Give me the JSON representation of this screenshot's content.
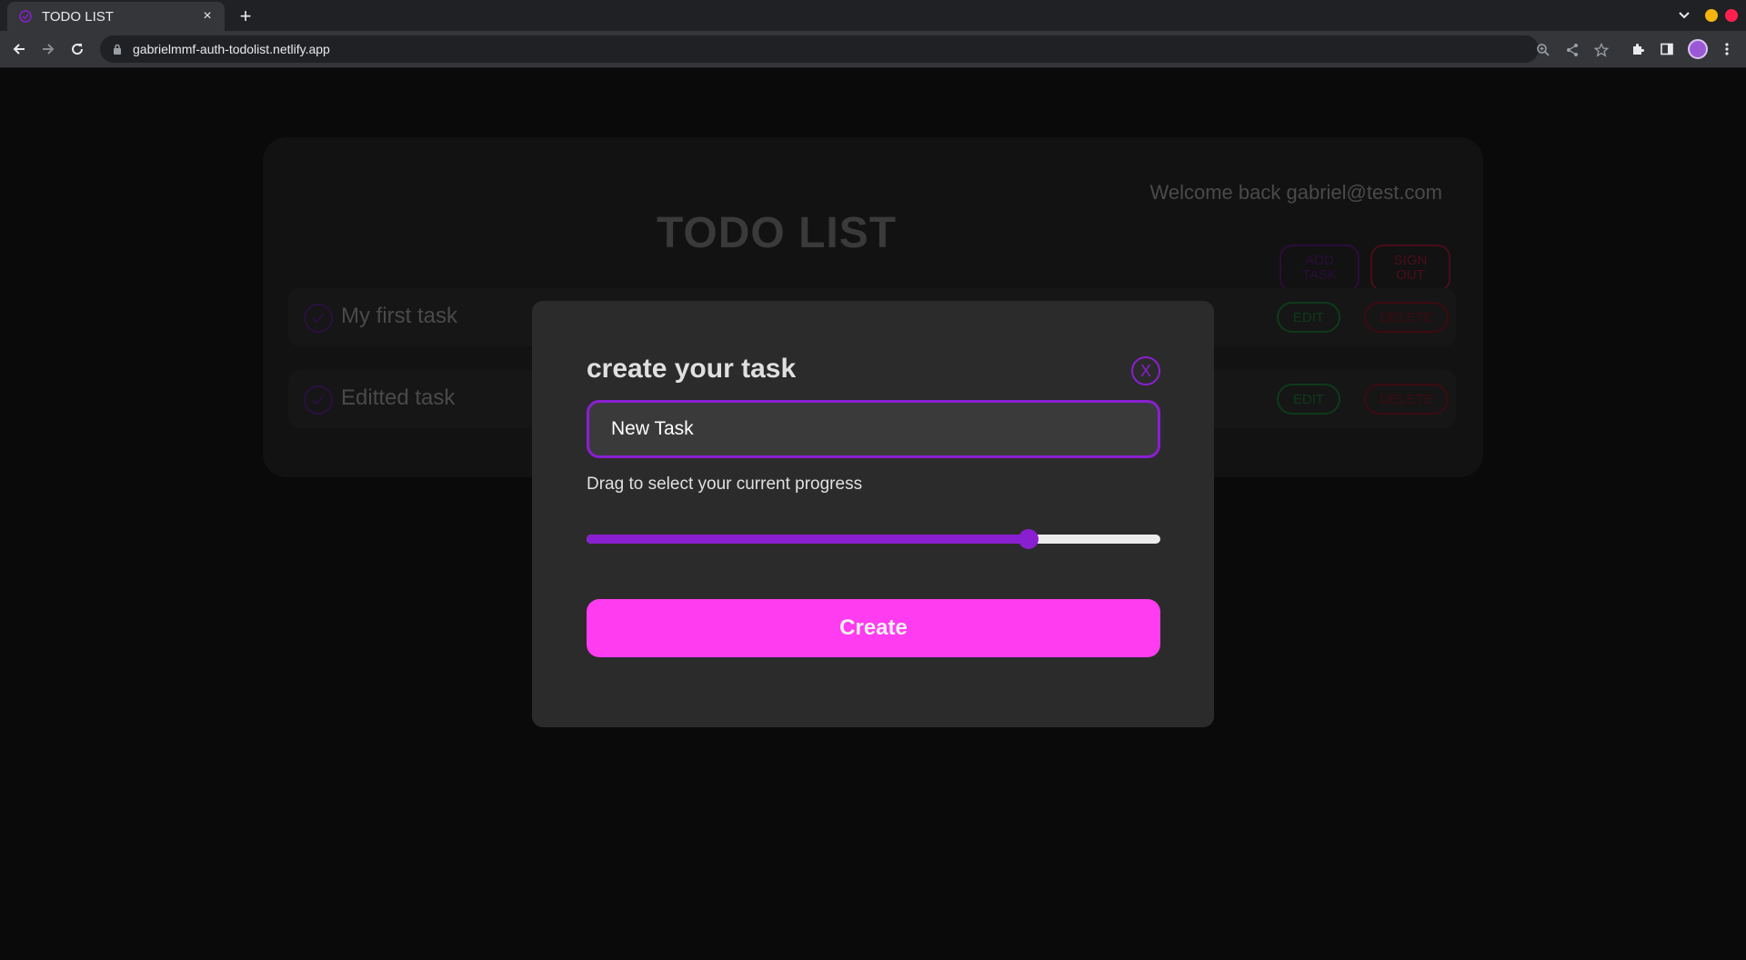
{
  "browser": {
    "tab_title": "TODO LIST",
    "tab_close": "×",
    "new_tab": "+",
    "url": "gabrielmmf-auth-todolist.netlify.app"
  },
  "colors": {
    "accent_purple": "#8a1fd1",
    "create_pink": "#ff3cf0",
    "edit_green": "#0e3a1a",
    "delete_red": "#3d0a12",
    "window_min": "#f5b50f",
    "window_close": "#ff2050"
  },
  "app": {
    "welcome": "Welcome back gabriel@test.com",
    "title": "TODO LIST",
    "add_task_label": "ADD\nTASK",
    "sign_out_label": "SIGN\nOUT",
    "tasks": [
      {
        "text": "My first task",
        "edit": "EDIT",
        "delete": "DELETE"
      },
      {
        "text": "Editted task",
        "edit": "EDIT",
        "delete": "DELETE"
      }
    ]
  },
  "modal": {
    "title": "create your task",
    "close_label": "X",
    "input_value": "New Task",
    "progress_label": "Drag to select your current progress",
    "progress_value": 0.77,
    "create_label": "Create"
  }
}
